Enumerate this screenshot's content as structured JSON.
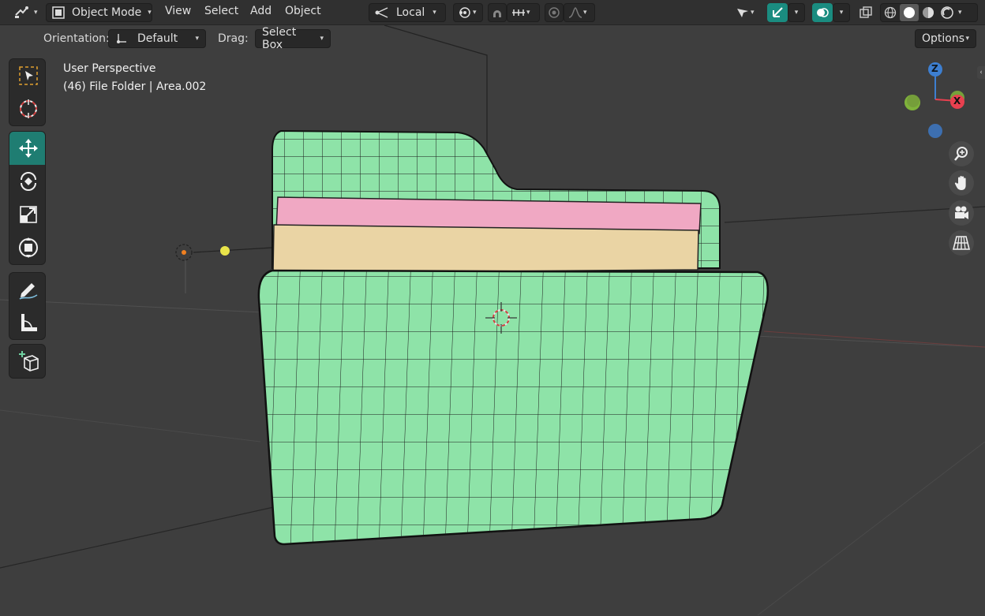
{
  "header": {
    "mode_label": "Object Mode",
    "menus": [
      "View",
      "Select",
      "Add",
      "Object"
    ],
    "transform_orientation": "Local"
  },
  "tool_settings": {
    "orientation_label": "Orientation:",
    "orientation_value": "Default",
    "drag_label": "Drag:",
    "drag_value": "Select Box",
    "options_label": "Options"
  },
  "viewport": {
    "view_name": "User Perspective",
    "object_info": "(46) File Folder | Area.002"
  },
  "gizmo": {
    "z_label": "Z",
    "x_label": "X"
  },
  "toolbar": {
    "tools": [
      "select-box",
      "cursor",
      "move",
      "rotate",
      "scale",
      "transform",
      "annotate",
      "measure",
      "add-cube"
    ],
    "active_tool": "move"
  },
  "colors": {
    "folder": "#8ee3a8",
    "paper_pink": "#f0a8c3",
    "paper_tan": "#ead4a4",
    "accent": "#1f7d72",
    "x_axis": "#e8404f",
    "y_axis": "#7fb33a",
    "z_axis": "#3d7fd1"
  }
}
